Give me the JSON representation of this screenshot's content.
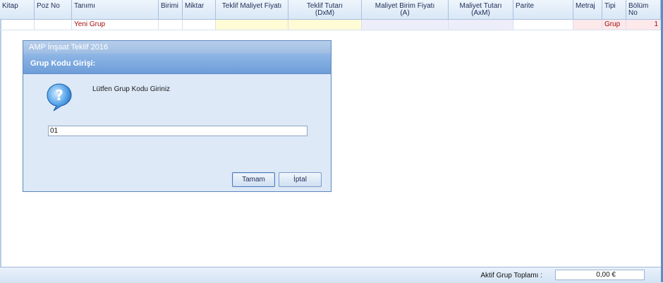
{
  "grid": {
    "columns": [
      {
        "label": "Kitap"
      },
      {
        "label": "Poz No"
      },
      {
        "label": "Tanımı"
      },
      {
        "label": "Birimi"
      },
      {
        "label": "Miktar"
      },
      {
        "label": "Teklif Maliyet Fiyatı"
      },
      {
        "label": "Teklif Tutarı\n(DxM)"
      },
      {
        "label": "Maliyet Birim Fiyatı\n(A)"
      },
      {
        "label": "Maliyet Tutarı\n(AxM)"
      },
      {
        "label": "Parite"
      },
      {
        "label": "Metraj"
      },
      {
        "label": "Tipi"
      },
      {
        "label": "Bölüm\nNo"
      }
    ],
    "row": {
      "tanimi": "Yeni Grup",
      "tipi": "Grup",
      "bolum_no": "1"
    },
    "colors": {
      "highlight_yellow": "#fffbd4",
      "highlight_lavender": "#eeeefa",
      "highlight_pink": "#fde8ea",
      "row_text_red": "#a01010"
    }
  },
  "footer": {
    "label": "Aktif Grup Toplamı :",
    "value": "0,00 €"
  },
  "dialog": {
    "window_title": "AMP İnşaat Teklif 2016",
    "heading": "Grup Kodu Girişi:",
    "icon": "question-icon",
    "prompt": "Lütfen Grup Kodu Giriniz",
    "input_value": "01",
    "ok_label": "Tamam",
    "cancel_label": "İptal"
  }
}
